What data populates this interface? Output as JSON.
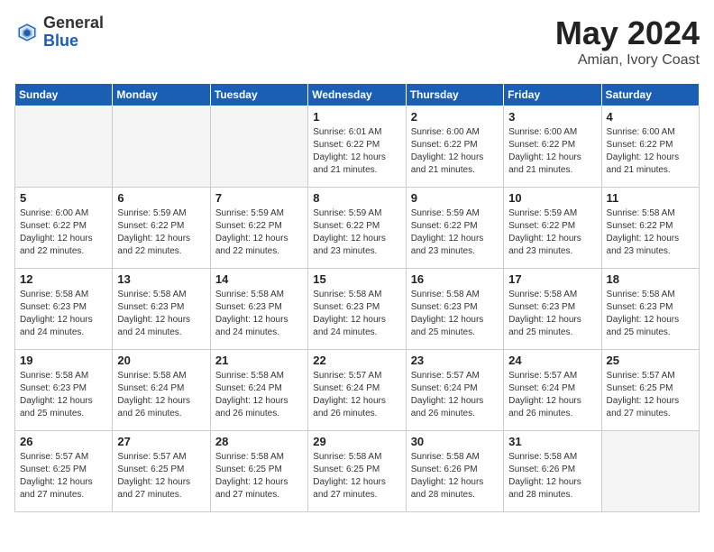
{
  "logo": {
    "general": "General",
    "blue": "Blue"
  },
  "title": {
    "month": "May 2024",
    "location": "Amian, Ivory Coast"
  },
  "headers": [
    "Sunday",
    "Monday",
    "Tuesday",
    "Wednesday",
    "Thursday",
    "Friday",
    "Saturday"
  ],
  "weeks": [
    [
      {
        "day": "",
        "info": ""
      },
      {
        "day": "",
        "info": ""
      },
      {
        "day": "",
        "info": ""
      },
      {
        "day": "1",
        "info": "Sunrise: 6:01 AM\nSunset: 6:22 PM\nDaylight: 12 hours\nand 21 minutes."
      },
      {
        "day": "2",
        "info": "Sunrise: 6:00 AM\nSunset: 6:22 PM\nDaylight: 12 hours\nand 21 minutes."
      },
      {
        "day": "3",
        "info": "Sunrise: 6:00 AM\nSunset: 6:22 PM\nDaylight: 12 hours\nand 21 minutes."
      },
      {
        "day": "4",
        "info": "Sunrise: 6:00 AM\nSunset: 6:22 PM\nDaylight: 12 hours\nand 21 minutes."
      }
    ],
    [
      {
        "day": "5",
        "info": "Sunrise: 6:00 AM\nSunset: 6:22 PM\nDaylight: 12 hours\nand 22 minutes."
      },
      {
        "day": "6",
        "info": "Sunrise: 5:59 AM\nSunset: 6:22 PM\nDaylight: 12 hours\nand 22 minutes."
      },
      {
        "day": "7",
        "info": "Sunrise: 5:59 AM\nSunset: 6:22 PM\nDaylight: 12 hours\nand 22 minutes."
      },
      {
        "day": "8",
        "info": "Sunrise: 5:59 AM\nSunset: 6:22 PM\nDaylight: 12 hours\nand 23 minutes."
      },
      {
        "day": "9",
        "info": "Sunrise: 5:59 AM\nSunset: 6:22 PM\nDaylight: 12 hours\nand 23 minutes."
      },
      {
        "day": "10",
        "info": "Sunrise: 5:59 AM\nSunset: 6:22 PM\nDaylight: 12 hours\nand 23 minutes."
      },
      {
        "day": "11",
        "info": "Sunrise: 5:58 AM\nSunset: 6:22 PM\nDaylight: 12 hours\nand 23 minutes."
      }
    ],
    [
      {
        "day": "12",
        "info": "Sunrise: 5:58 AM\nSunset: 6:23 PM\nDaylight: 12 hours\nand 24 minutes."
      },
      {
        "day": "13",
        "info": "Sunrise: 5:58 AM\nSunset: 6:23 PM\nDaylight: 12 hours\nand 24 minutes."
      },
      {
        "day": "14",
        "info": "Sunrise: 5:58 AM\nSunset: 6:23 PM\nDaylight: 12 hours\nand 24 minutes."
      },
      {
        "day": "15",
        "info": "Sunrise: 5:58 AM\nSunset: 6:23 PM\nDaylight: 12 hours\nand 24 minutes."
      },
      {
        "day": "16",
        "info": "Sunrise: 5:58 AM\nSunset: 6:23 PM\nDaylight: 12 hours\nand 25 minutes."
      },
      {
        "day": "17",
        "info": "Sunrise: 5:58 AM\nSunset: 6:23 PM\nDaylight: 12 hours\nand 25 minutes."
      },
      {
        "day": "18",
        "info": "Sunrise: 5:58 AM\nSunset: 6:23 PM\nDaylight: 12 hours\nand 25 minutes."
      }
    ],
    [
      {
        "day": "19",
        "info": "Sunrise: 5:58 AM\nSunset: 6:23 PM\nDaylight: 12 hours\nand 25 minutes."
      },
      {
        "day": "20",
        "info": "Sunrise: 5:58 AM\nSunset: 6:24 PM\nDaylight: 12 hours\nand 26 minutes."
      },
      {
        "day": "21",
        "info": "Sunrise: 5:58 AM\nSunset: 6:24 PM\nDaylight: 12 hours\nand 26 minutes."
      },
      {
        "day": "22",
        "info": "Sunrise: 5:57 AM\nSunset: 6:24 PM\nDaylight: 12 hours\nand 26 minutes."
      },
      {
        "day": "23",
        "info": "Sunrise: 5:57 AM\nSunset: 6:24 PM\nDaylight: 12 hours\nand 26 minutes."
      },
      {
        "day": "24",
        "info": "Sunrise: 5:57 AM\nSunset: 6:24 PM\nDaylight: 12 hours\nand 26 minutes."
      },
      {
        "day": "25",
        "info": "Sunrise: 5:57 AM\nSunset: 6:25 PM\nDaylight: 12 hours\nand 27 minutes."
      }
    ],
    [
      {
        "day": "26",
        "info": "Sunrise: 5:57 AM\nSunset: 6:25 PM\nDaylight: 12 hours\nand 27 minutes."
      },
      {
        "day": "27",
        "info": "Sunrise: 5:57 AM\nSunset: 6:25 PM\nDaylight: 12 hours\nand 27 minutes."
      },
      {
        "day": "28",
        "info": "Sunrise: 5:58 AM\nSunset: 6:25 PM\nDaylight: 12 hours\nand 27 minutes."
      },
      {
        "day": "29",
        "info": "Sunrise: 5:58 AM\nSunset: 6:25 PM\nDaylight: 12 hours\nand 27 minutes."
      },
      {
        "day": "30",
        "info": "Sunrise: 5:58 AM\nSunset: 6:26 PM\nDaylight: 12 hours\nand 28 minutes."
      },
      {
        "day": "31",
        "info": "Sunrise: 5:58 AM\nSunset: 6:26 PM\nDaylight: 12 hours\nand 28 minutes."
      },
      {
        "day": "",
        "info": ""
      }
    ]
  ]
}
